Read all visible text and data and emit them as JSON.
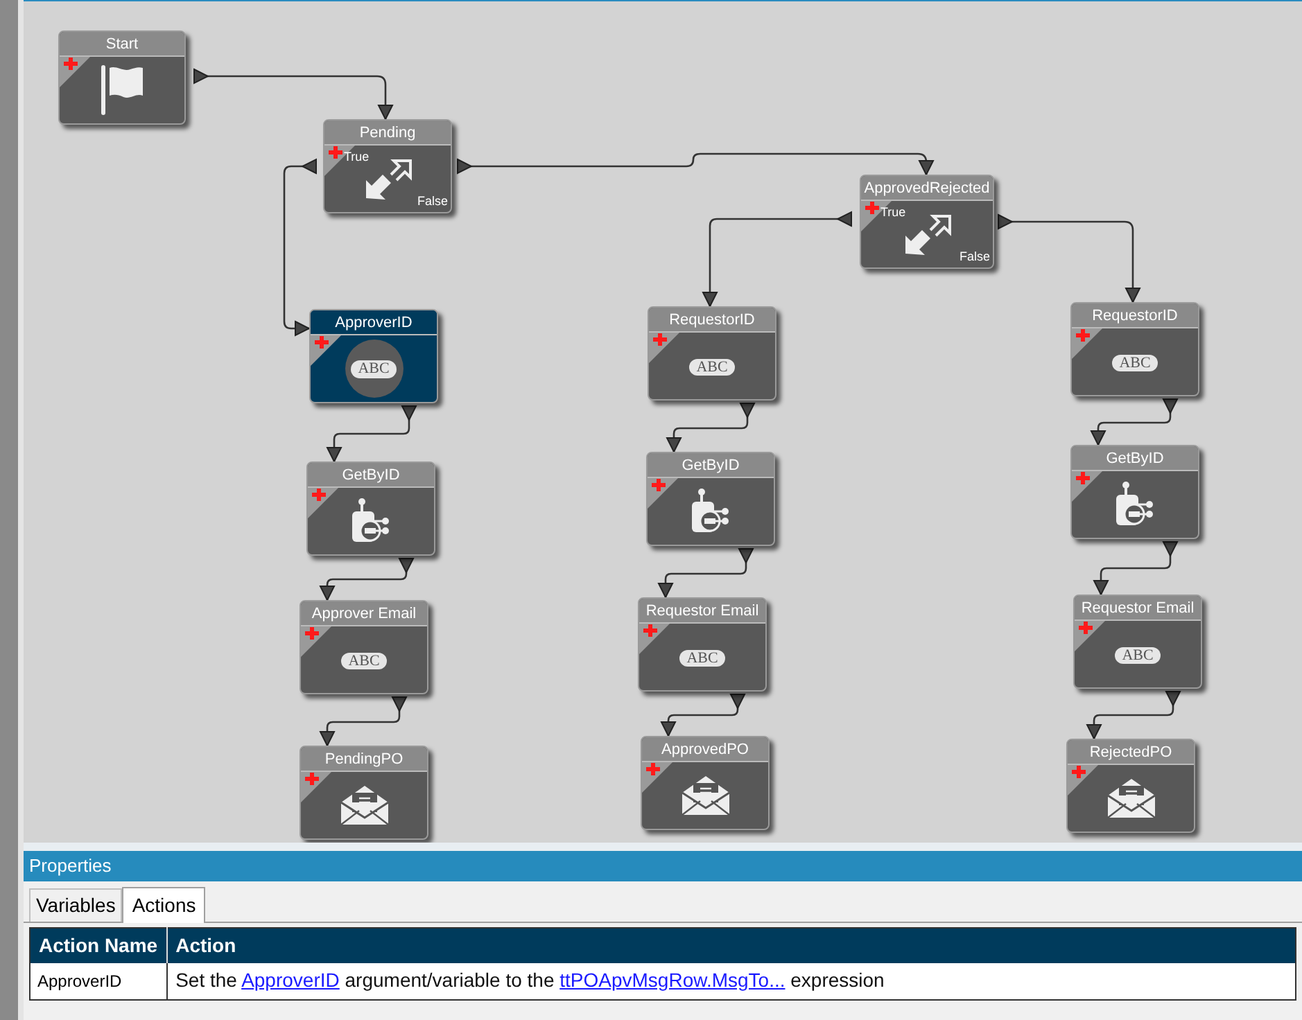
{
  "canvas": {
    "nodes": [
      {
        "title": "Start",
        "kind": "start",
        "selected": false
      },
      {
        "title": "Pending",
        "kind": "decision",
        "selected": false,
        "true_label": "True",
        "false_label": "False"
      },
      {
        "title": "ApprovedRejected",
        "kind": "decision",
        "selected": false,
        "true_label": "True",
        "false_label": "False"
      },
      {
        "title": "ApproverID",
        "kind": "variable",
        "selected": true,
        "icon_text": "ABC"
      },
      {
        "title": "GetByID",
        "kind": "service",
        "selected": false
      },
      {
        "title": "Approver Email",
        "kind": "variable",
        "selected": false,
        "icon_text": "ABC"
      },
      {
        "title": "PendingPO",
        "kind": "email",
        "selected": false
      },
      {
        "title": "RequestorID",
        "kind": "variable",
        "selected": false,
        "icon_text": "ABC"
      },
      {
        "title": "GetByID",
        "kind": "service",
        "selected": false
      },
      {
        "title": "Requestor Email",
        "kind": "variable",
        "selected": false,
        "icon_text": "ABC"
      },
      {
        "title": "ApprovedPO",
        "kind": "email",
        "selected": false
      },
      {
        "title": "RequestorID",
        "kind": "variable",
        "selected": false,
        "icon_text": "ABC"
      },
      {
        "title": "GetByID",
        "kind": "service",
        "selected": false
      },
      {
        "title": "Requestor Email",
        "kind": "variable",
        "selected": false,
        "icon_text": "ABC"
      },
      {
        "title": "RejectedPO",
        "kind": "email",
        "selected": false
      }
    ]
  },
  "properties": {
    "title": "Properties",
    "tabs": [
      {
        "label": "Variables",
        "selected": false
      },
      {
        "label": "Actions",
        "selected": true
      }
    ],
    "table": {
      "columns": [
        "Action Name",
        "Action"
      ],
      "rows": [
        {
          "action_name": "ApproverID",
          "action": [
            {
              "kind": "text",
              "text": "Set the "
            },
            {
              "kind": "link",
              "text": "ApproverID"
            },
            {
              "kind": "text",
              "text": " argument/variable to the "
            },
            {
              "kind": "link",
              "text": "ttPOApvMsgRow.MsgTo..."
            },
            {
              "kind": "text",
              "text": " expression"
            }
          ]
        }
      ]
    }
  }
}
